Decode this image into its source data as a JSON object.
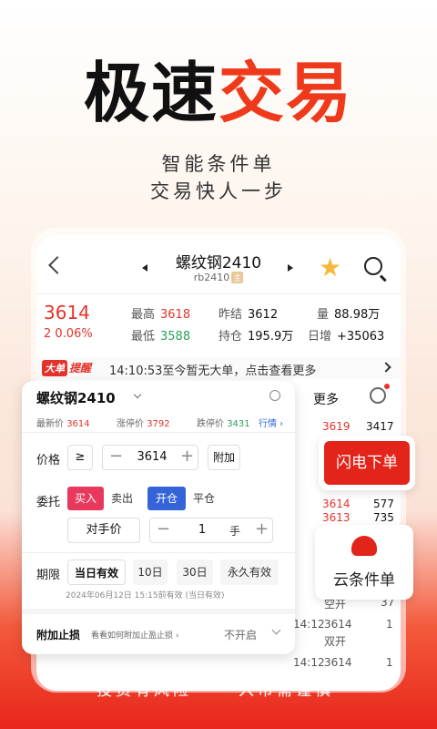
{
  "hero": {
    "title_part1": "极速",
    "title_part2": "交易",
    "subtitle1": "智能条件单",
    "subtitle2": "交易快人一步"
  },
  "nav": {
    "contract_name": "螺纹钢2410",
    "contract_code": "rb2410",
    "code_badge": "主"
  },
  "quote": {
    "last": "3614",
    "change": "2 0.06%",
    "high_label": "最高",
    "high": "3618",
    "low_label": "最低",
    "low": "3588",
    "prev_settle_label": "昨结",
    "prev_settle": "3612",
    "open_interest_label": "持仓",
    "open_interest": "195.9万",
    "volume_label": "量",
    "volume": "88.98万",
    "daily_change_label": "日增",
    "daily_change": "+35063"
  },
  "big_order": {
    "tag1": "大单",
    "tag2": "提醒",
    "text": "14:10:53至今暂无大单，点击查看更多"
  },
  "toolbar": {
    "more_label": "更多"
  },
  "orderbook": [
    {
      "price": "3619",
      "vol": "3417"
    },
    {
      "price": "3614",
      "vol": "577"
    },
    {
      "price": "3613",
      "vol": "735"
    }
  ],
  "panel": {
    "contract_name": "螺纹钢2410",
    "stats": {
      "last_label": "最新价",
      "last": "3614",
      "limit_up_label": "涨停价",
      "limit_up": "3792",
      "limit_down_label": "跌停价",
      "limit_down": "3431",
      "market_link": "行情 ›"
    },
    "price_label": "价格",
    "price_op": "≥",
    "price_value": "3614",
    "attach_label": "附加",
    "entrust_label": "委托",
    "buy": "买入",
    "sell": "卖出",
    "open": "开仓",
    "close": "平仓",
    "opponent_price": "对手价",
    "qty": "1",
    "qty_unit": "手",
    "period_label": "期限",
    "valid_today": "当日有效",
    "valid_10": "10日",
    "valid_30": "30日",
    "valid_forever": "永久有效",
    "valid_note": "2024年06月12日 15:15前有效 (当日有效)",
    "stoploss_label": "附加止损",
    "stoploss_hint": "看看如何附加止盈止损 ›",
    "stoploss_value": "不开启"
  },
  "flash_order": {
    "label": "闪电下单"
  },
  "cloud_order": {
    "label": "云条件单"
  },
  "lower_book": [
    {
      "time": "",
      "price": "",
      "text": "空开",
      "num": "37"
    },
    {
      "time": "14:12",
      "price": "3614",
      "text": "",
      "num": "1"
    },
    {
      "time": "",
      "price": "",
      "text": "双开",
      "num": ""
    },
    {
      "time": "14:12",
      "price": "3614",
      "text": "",
      "num": "1"
    }
  ],
  "disclaimer": {
    "part1": "投资有风险",
    "part2": "入市需谨慎"
  },
  "colors": {
    "accent": "#ee3a1b",
    "up": "#e4332a",
    "down": "#2aa35a",
    "buy": "#e8395d",
    "open": "#3564d8"
  }
}
